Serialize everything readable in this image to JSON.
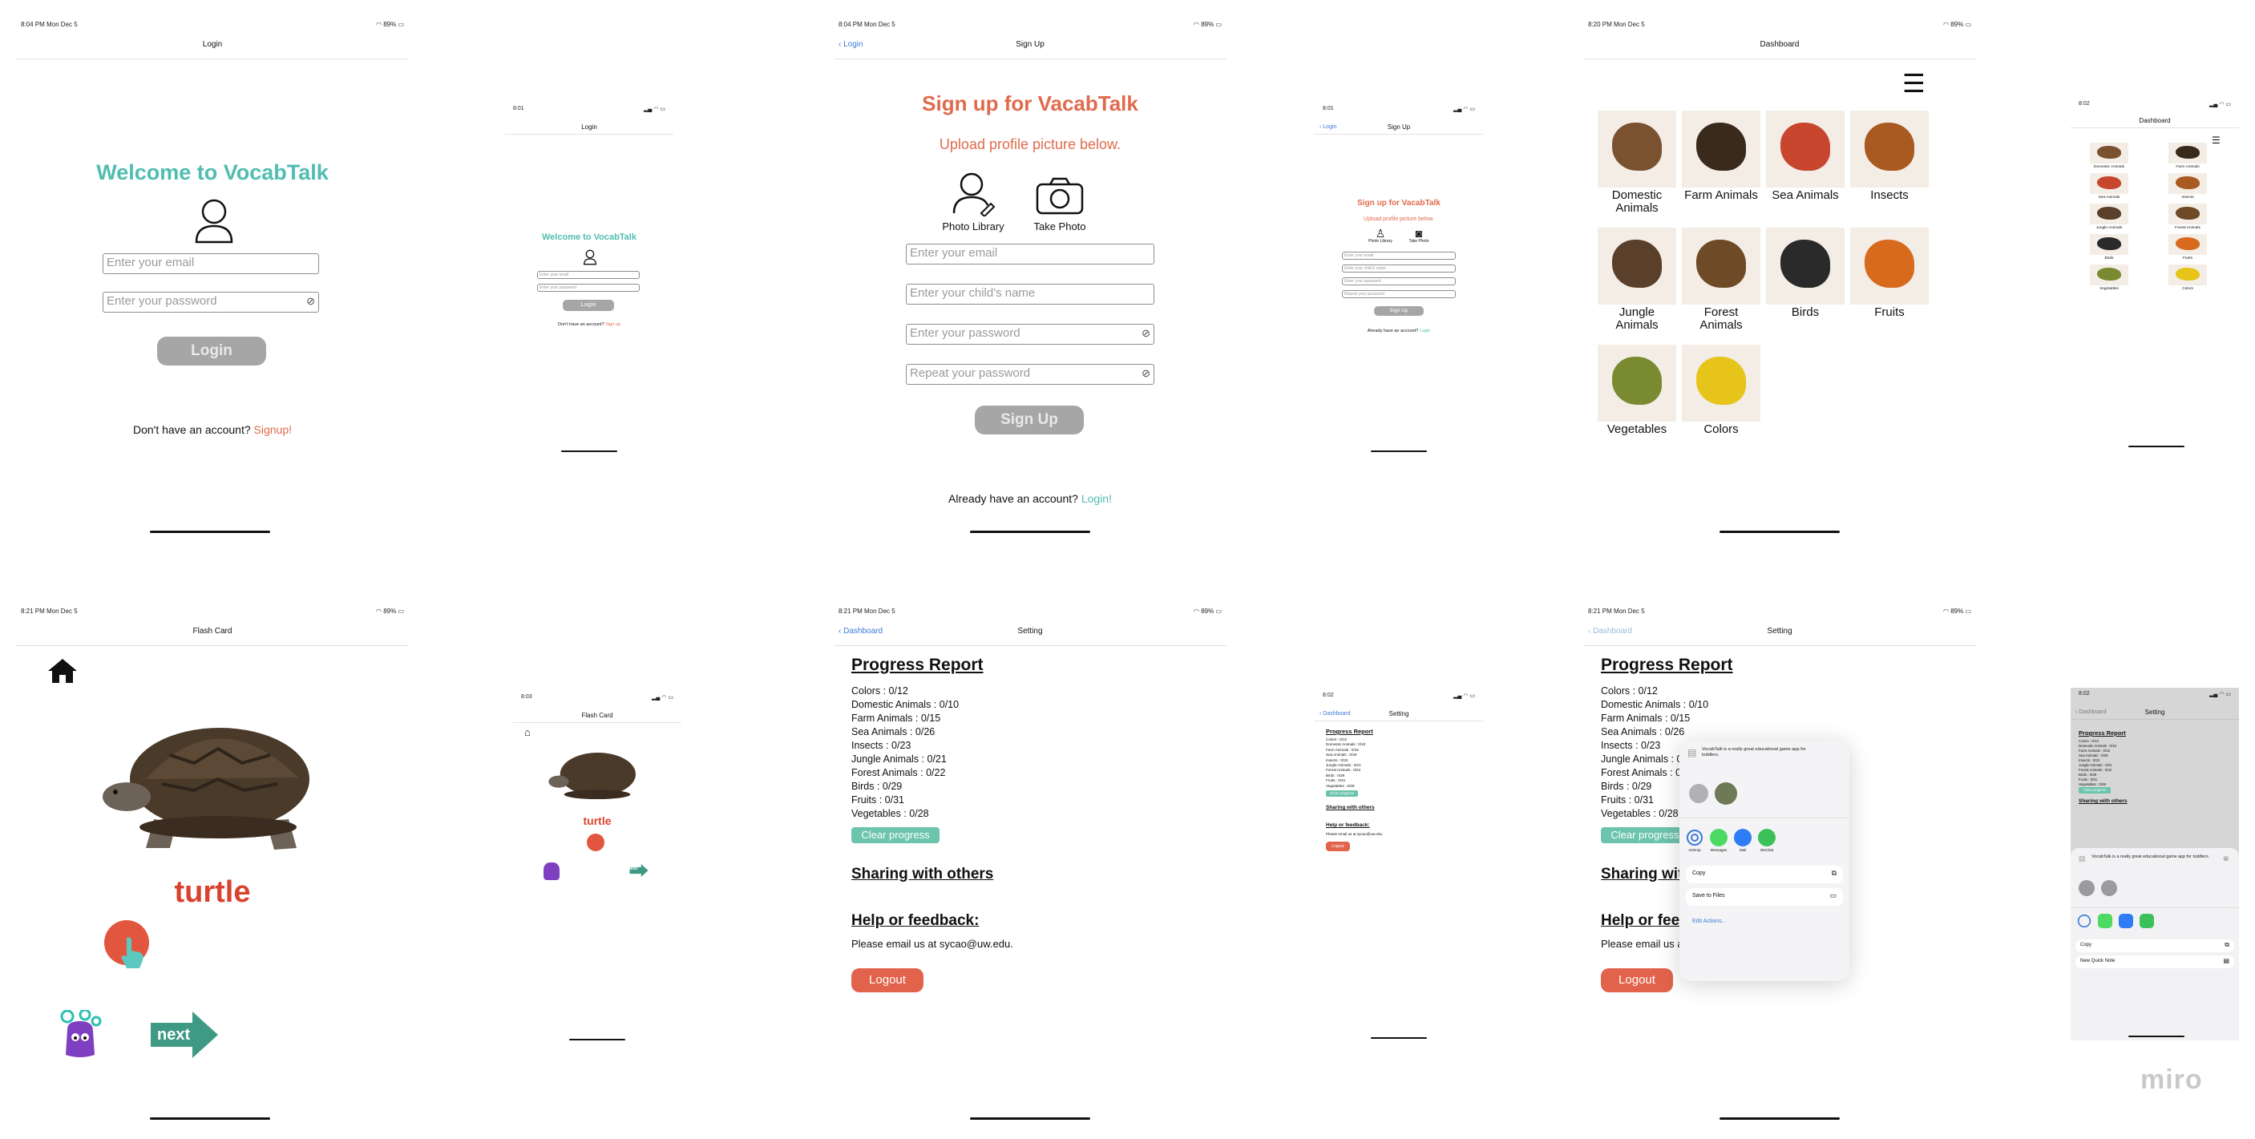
{
  "status": {
    "big_time": "8:04 PM   Mon Dec 5",
    "battery": "89%",
    "small_time": "8:01",
    "time_820": "8:20 PM   Mon Dec 5",
    "time_802": "8:02",
    "time_821": "8:21 PM   Mon Dec 5",
    "time_803": "8:03"
  },
  "login": {
    "nav_title": "Login",
    "welcome": "Welcome to VocabTalk",
    "email_placeholder": "Enter your email",
    "password_placeholder": "Enter your password",
    "button": "Login",
    "no_account": "Don't have an account? ",
    "signup_link": "Signup!",
    "signup_link_small": "Sign up"
  },
  "signup": {
    "nav_title": "Sign Up",
    "back": "Login",
    "title": "Sign up for VacabTalk",
    "subtitle": "Upload profile picture below.",
    "photo_library": "Photo Library",
    "take_photo": "Take Photo",
    "email_placeholder": "Enter your email",
    "child_placeholder": "Enter your child's name",
    "password_placeholder": "Enter your password",
    "repeat_placeholder": "Repeat your password",
    "button": "Sign Up",
    "have_account": "Already have an account? ",
    "login_link": "Login!",
    "login_link_small": "Login"
  },
  "dashboard": {
    "nav_title": "Dashboard",
    "categories": [
      "Domestic Animals",
      "Farm Animals",
      "Sea Animals",
      "Insects",
      "Jungle Animals",
      "Forest Animals",
      "Birds",
      "Fruits",
      "Vegetables",
      "Colors"
    ]
  },
  "flashcard": {
    "nav_title": "Flash Card",
    "word": "turtle",
    "next": "next"
  },
  "setting": {
    "nav_title": "Setting",
    "back": "Dashboard",
    "progress_heading": "Progress Report",
    "progress": [
      "Colors : 0/12",
      "Domestic Animals : 0/10",
      "Farm Animals : 0/15",
      "Sea Animals : 0/26",
      "Insects : 0/23",
      "Jungle Animals : 0/21",
      "Forest Animals : 0/22",
      "Birds : 0/29",
      "Fruits : 0/31",
      "Vegetables : 0/28"
    ],
    "clear": "Clear progress",
    "sharing": "Sharing with others",
    "help": "Help or feedback:",
    "email_line": "Please email us at sycao@uw.edu.",
    "logout": "Logout"
  },
  "share_sheet": {
    "message": "VocabTalk is a really great educational game app for toddlers.",
    "apps": [
      "AirDrop",
      "Messages",
      "Mail",
      "WeChat"
    ],
    "copy": "Copy",
    "save_files": "Save to Files",
    "edit_actions": "Edit Actions...",
    "new_quick_note": "New Quick Note"
  },
  "brand": {
    "miro": "miro"
  },
  "colors": {
    "teal": "#4fbdb0",
    "orange": "#e06a4d",
    "ios_blue": "#3a7bd5",
    "gray_button": "#a6a6a6",
    "clear_teal": "#6cc4ad",
    "logout_red": "#e2634c"
  }
}
